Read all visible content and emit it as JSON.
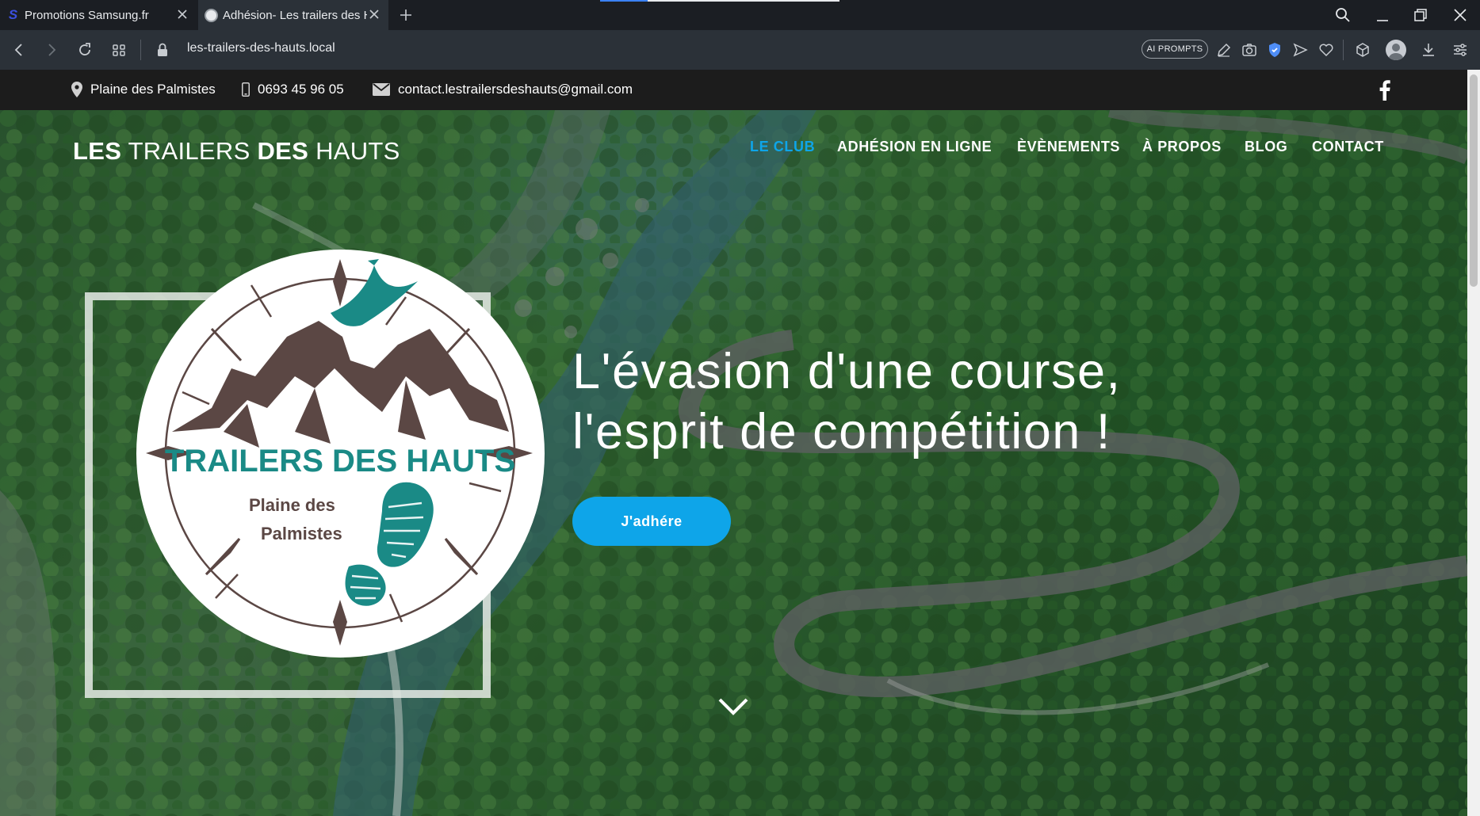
{
  "browser": {
    "tabs": [
      {
        "title": "Promotions Samsung.fr",
        "icon": "samsung-s-icon",
        "active": false
      },
      {
        "title": "Adhésion- Les trailers des Hauts",
        "icon": "globe-icon",
        "active": true
      }
    ],
    "address": "les-trailers-des-hauts.local",
    "ai_button": "AI PROMPTS"
  },
  "topbar": {
    "location": "Plaine des Palmistes",
    "phone": "0693 45 96 05",
    "email": "contact.lestrailersdeshauts@gmail.com"
  },
  "site": {
    "brand": {
      "w1": "LES",
      "w2": "TRAILERS",
      "w3": "DES",
      "w4": "HAUTS"
    },
    "nav": [
      {
        "label": "LE CLUB",
        "active": true
      },
      {
        "label": "ADHÉSION EN LIGNE",
        "active": false
      },
      {
        "label": "ÈVÈNEMENTS",
        "active": false
      },
      {
        "label": "À PROPOS",
        "active": false
      },
      {
        "label": "BLOG",
        "active": false
      },
      {
        "label": "CONTACT",
        "active": false
      }
    ],
    "logo": {
      "title": "TRAILERS DES HAUTS",
      "line1": "Plaine des",
      "line2": "Palmistes"
    },
    "headline": {
      "line1": "L'évasion d'une course,",
      "line2": "l'esprit de compétition !"
    },
    "cta": "J'adhére"
  },
  "colors": {
    "accent": "#0ea5e9",
    "logo_teal": "#1a8a86",
    "logo_brown": "#5b4744",
    "topbar": "#1c1c1c"
  }
}
